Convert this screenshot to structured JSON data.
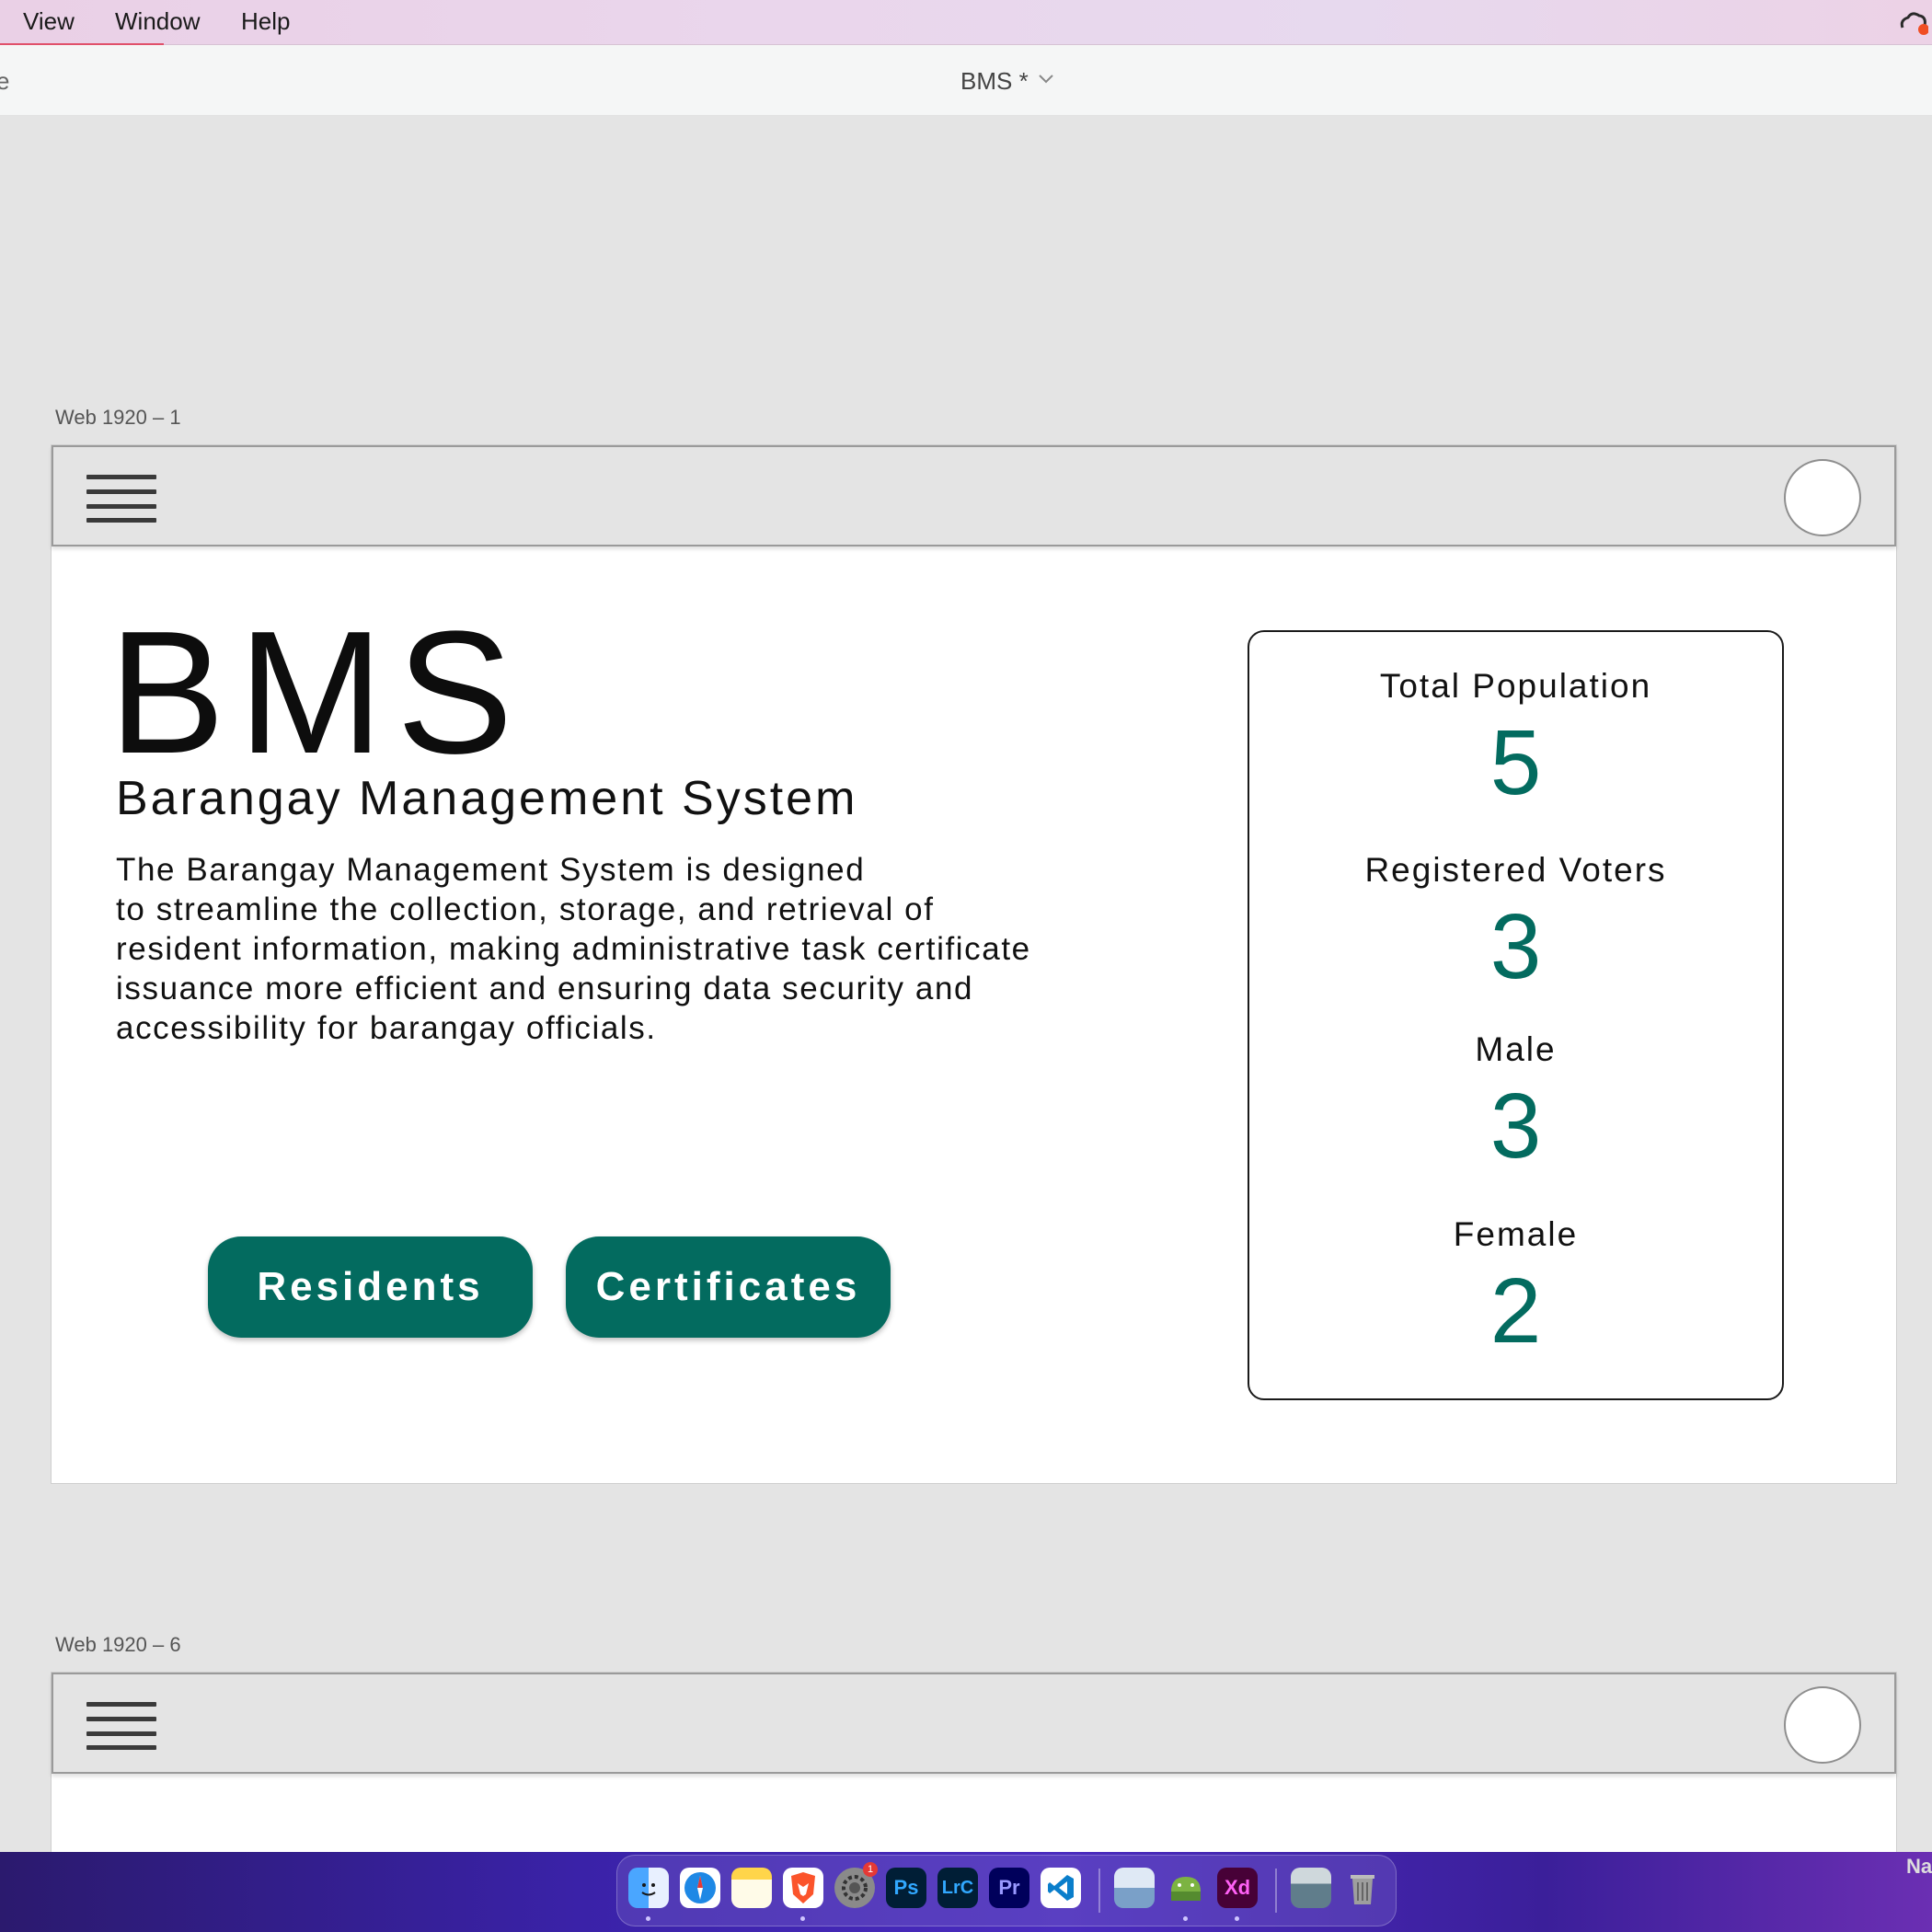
{
  "menubar": {
    "items": [
      "View",
      "Window",
      "Help"
    ]
  },
  "titlebar": {
    "left_fragment": "e",
    "document_title": "BMS *"
  },
  "artboards": [
    {
      "label": "Web 1920 – 1"
    },
    {
      "label": "Web 1920 – 6"
    }
  ],
  "hero": {
    "title": "BMS",
    "subtitle": "Barangay Management System",
    "description_lines": [
      "The Barangay Management System is designed",
      "to streamline the collection, storage, and retrieval of",
      "resident information, making administrative task certificate",
      "issuance more efficient and ensuring data security and",
      "accessibility for barangay officials."
    ],
    "buttons": {
      "residents": "Residents",
      "certificates": "Certificates"
    }
  },
  "stats": [
    {
      "label": "Total Population",
      "value": "5"
    },
    {
      "label": "Registered Voters",
      "value": "3"
    },
    {
      "label": "Male",
      "value": "3"
    },
    {
      "label": "Female",
      "value": "2"
    }
  ],
  "dock": {
    "apps": [
      {
        "name": "finder-icon"
      },
      {
        "name": "safari-icon"
      },
      {
        "name": "notes-icon"
      },
      {
        "name": "brave-icon"
      },
      {
        "name": "system-settings-icon",
        "badge": "1"
      },
      {
        "name": "photoshop-icon",
        "text": "Ps"
      },
      {
        "name": "lightroom-classic-icon",
        "text": "LrC"
      },
      {
        "name": "premiere-pro-icon",
        "text": "Pr"
      },
      {
        "name": "vscode-icon"
      },
      {
        "name": "preview-icon"
      },
      {
        "name": "android-studio-icon"
      },
      {
        "name": "adobe-xd-icon",
        "text": "Xd"
      },
      {
        "name": "image-capture-icon"
      },
      {
        "name": "trash-icon"
      }
    ],
    "corner_text": "Na"
  },
  "colors": {
    "brand_green": "#036b5f",
    "menubar_accent": "#e0506a"
  }
}
